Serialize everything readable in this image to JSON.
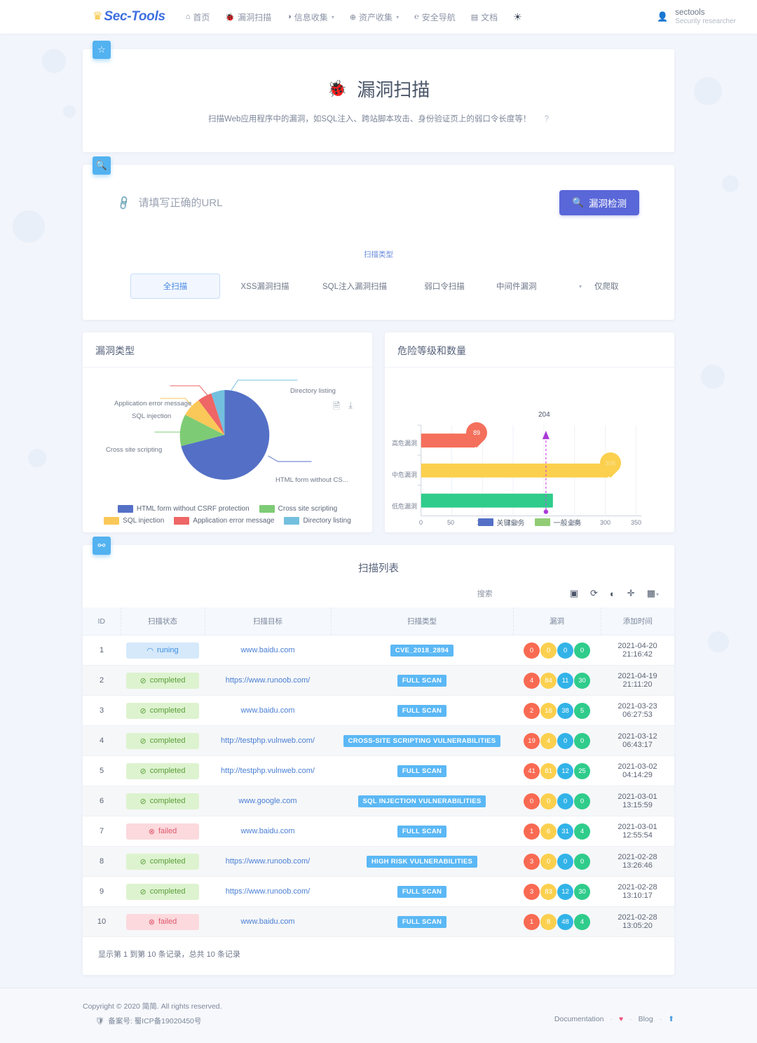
{
  "header": {
    "brand": "Sec-Tools",
    "crown_icon": "crown-icon",
    "nav": [
      {
        "label": "首页",
        "icon": "home-icon",
        "has_caret": false
      },
      {
        "label": "漏洞扫描",
        "icon": "bug-icon",
        "has_caret": false
      },
      {
        "label": "信息收集",
        "icon": "globe-icon",
        "has_caret": true
      },
      {
        "label": "资产收集",
        "icon": "network-icon",
        "has_caret": true
      },
      {
        "label": "安全导航",
        "icon": "compass-icon",
        "has_caret": false
      },
      {
        "label": "文档",
        "icon": "book-icon",
        "has_caret": false
      }
    ],
    "emoji": "☀",
    "user": {
      "name": "sectools",
      "role": "Security researcher",
      "avatar_icon": "user-avatar-icon"
    }
  },
  "hero": {
    "badge_icon": "star-icon",
    "title": "漏洞扫描",
    "bug_icon": "bug-icon",
    "description": "扫描Web应用程序中的漏洞，如SQL注入、跨站脚本攻击、身份验证页上的弱口令长度等！",
    "help": "?"
  },
  "scan_form": {
    "badge_icon": "search-icon",
    "clip_icon": "link-icon",
    "url_placeholder": "请填写正确的URL",
    "url_value": "",
    "submit_label": "漏洞检测",
    "submit_icon": "search-icon",
    "types_label": "扫描类型",
    "types": [
      {
        "label": "全扫描",
        "active": true
      },
      {
        "label": "XSS漏洞扫描",
        "active": false
      },
      {
        "label": "SQL注入漏洞扫描",
        "active": false
      },
      {
        "label": "弱口令扫描",
        "active": false
      }
    ],
    "select_value": "中间件漏洞",
    "select_caret_icon": "chevron-down-icon",
    "last_option": "仅爬取"
  },
  "chart_data": [
    {
      "type": "pie",
      "title": "漏洞类型",
      "categories": [
        "HTML form without CSRF protection",
        "Cross site scripting",
        "SQL injection",
        "Application error message",
        "Directory listing"
      ],
      "values": [
        68,
        15,
        8,
        5,
        4
      ],
      "colors": [
        "#5470c6",
        "#7ecb75",
        "#fac858",
        "#ee6666",
        "#73c0de"
      ],
      "callout_labels": [
        "HTML form without CS...",
        "Cross site scripting",
        "SQL injection",
        "Application error message",
        "Directory listing"
      ],
      "legend_position": "bottom",
      "tools": [
        "document-icon",
        "download-icon"
      ]
    },
    {
      "type": "bar",
      "title": "危险等级和数量",
      "orientation": "horizontal",
      "categories": [
        "高危漏洞",
        "中危漏洞",
        "低危漏洞"
      ],
      "values": [
        89,
        306,
        215
      ],
      "value_labels": [
        "89",
        "306",
        ""
      ],
      "colors": [
        "#f4705c",
        "#fbd04e",
        "#2fcc8b"
      ],
      "xlabel": "",
      "ylabel": "",
      "xticks": [
        "0",
        "50",
        "100",
        "150",
        "200",
        "250",
        "300",
        "350"
      ],
      "xlim": [
        0,
        350
      ],
      "marker": {
        "value": 204,
        "label": "204",
        "color": "#a93ad8"
      },
      "legend": [
        {
          "label": "关键业务",
          "color": "#5470c6"
        },
        {
          "label": "一般业务",
          "color": "#91cc75"
        }
      ],
      "legend_position": "bottom"
    }
  ],
  "scan_list": {
    "badge_icon": "list-icon",
    "title": "扫描列表",
    "search_placeholder": "搜索",
    "tools": [
      "export-icon",
      "refresh-icon",
      "contrast-icon",
      "fullscreen-icon",
      "columns-icon"
    ],
    "columns": [
      "ID",
      "扫描状态",
      "扫描目标",
      "扫描类型",
      "漏洞",
      "添加时间"
    ],
    "rows": [
      {
        "id": "1",
        "status": "runing",
        "status_kind": "running",
        "target": "www.baidu.com",
        "type": "CVE_2018_2894",
        "vulns": [
          "0",
          "0",
          "0",
          "0"
        ],
        "time": "2021-04-20 21:16:42"
      },
      {
        "id": "2",
        "status": "completed",
        "status_kind": "completed",
        "target": "https://www.runoob.com/",
        "type": "FULL SCAN",
        "vulns": [
          "4",
          "84",
          "11",
          "30"
        ],
        "time": "2021-04-19 21:11:20"
      },
      {
        "id": "3",
        "status": "completed",
        "status_kind": "completed",
        "target": "www.baidu.com",
        "type": "FULL SCAN",
        "vulns": [
          "2",
          "16",
          "38",
          "5"
        ],
        "time": "2021-03-23 06:27:53"
      },
      {
        "id": "4",
        "status": "completed",
        "status_kind": "completed",
        "target": "http://testphp.vulnweb.com/",
        "type": "CROSS-SITE SCRIPTING VULNERABILITIES",
        "vulns": [
          "19",
          "4",
          "0",
          "0"
        ],
        "time": "2021-03-12 06:43:17"
      },
      {
        "id": "5",
        "status": "completed",
        "status_kind": "completed",
        "target": "http://testphp.vulnweb.com/",
        "type": "FULL SCAN",
        "vulns": [
          "41",
          "81",
          "12",
          "25"
        ],
        "time": "2021-03-02 04:14:29"
      },
      {
        "id": "6",
        "status": "completed",
        "status_kind": "completed",
        "target": "www.google.com",
        "type": "SQL INJECTION VULNERABILITIES",
        "vulns": [
          "0",
          "0",
          "0",
          "0"
        ],
        "time": "2021-03-01 13:15:59"
      },
      {
        "id": "7",
        "status": "failed",
        "status_kind": "failed",
        "target": "www.baidu.com",
        "type": "FULL SCAN",
        "vulns": [
          "1",
          "6",
          "31",
          "4"
        ],
        "time": "2021-03-01 12:55:54"
      },
      {
        "id": "8",
        "status": "completed",
        "status_kind": "completed",
        "target": "https://www.runoob.com/",
        "type": "HIGH RISK VULNERABILITIES",
        "vulns": [
          "3",
          "0",
          "0",
          "0"
        ],
        "time": "2021-02-28 13:26:46"
      },
      {
        "id": "9",
        "status": "completed",
        "status_kind": "completed",
        "target": "https://www.runoob.com/",
        "type": "FULL SCAN",
        "vulns": [
          "3",
          "83",
          "12",
          "30"
        ],
        "time": "2021-02-28 13:10:17"
      },
      {
        "id": "10",
        "status": "failed",
        "status_kind": "failed",
        "target": "www.baidu.com",
        "type": "FULL SCAN",
        "vulns": [
          "1",
          "8",
          "48",
          "4"
        ],
        "time": "2021-02-28 13:05:20"
      }
    ],
    "summary": "显示第 1 到第 10 条记录，总共 10 条记录"
  },
  "footer": {
    "copyright": "Copyright © 2020 简简. All rights reserved.",
    "beian_icon": "police-badge-icon",
    "beian": "备案号: 蜀ICP备19020450号",
    "links": [
      "Documentation",
      "Blog"
    ],
    "heart_icon": "heart-icon",
    "up_icon": "back-to-top-icon"
  }
}
